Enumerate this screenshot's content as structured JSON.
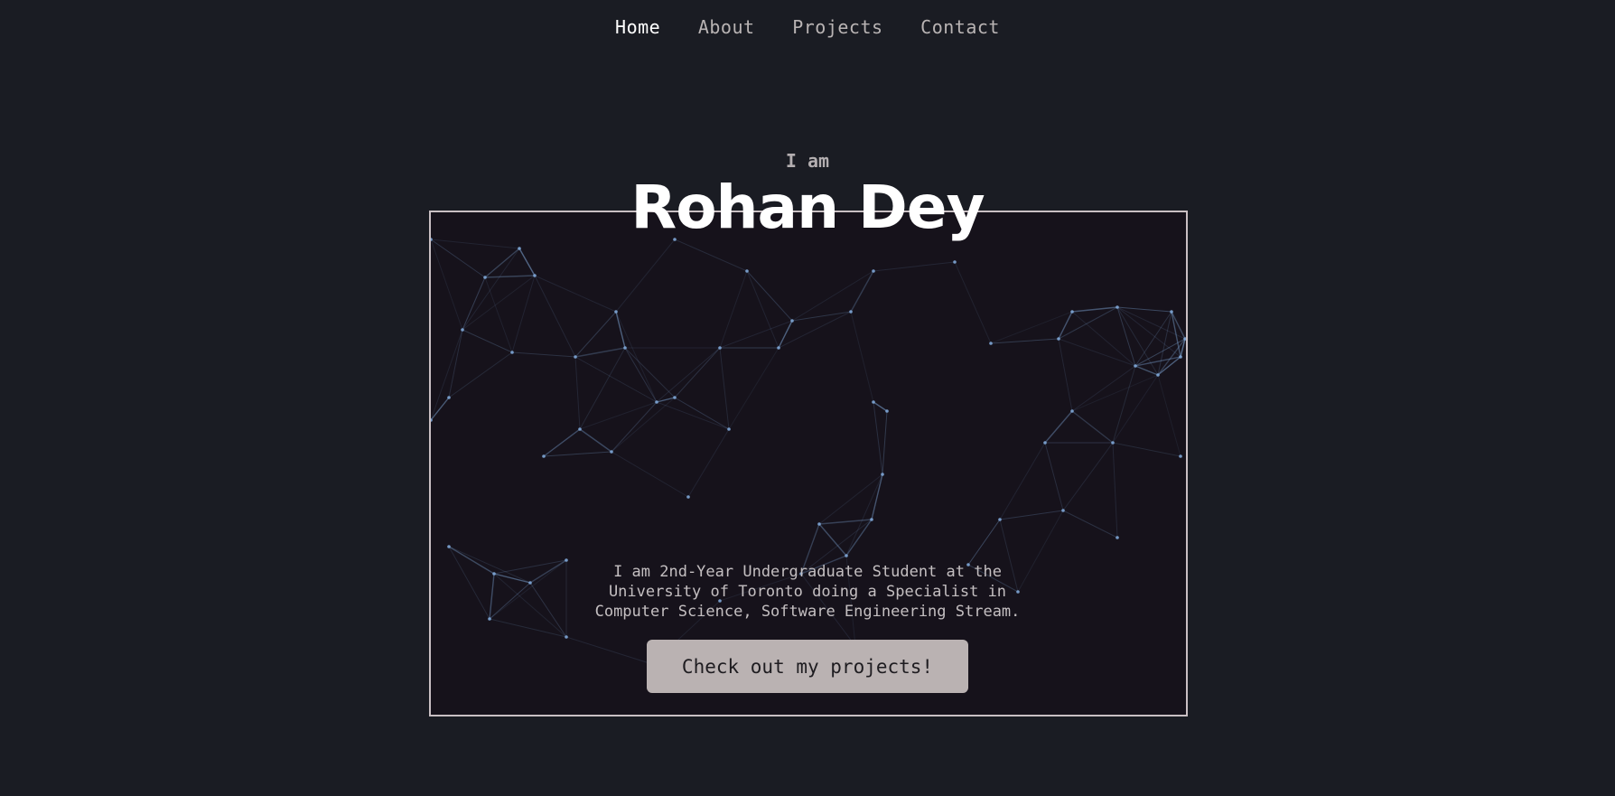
{
  "nav": {
    "items": [
      {
        "label": "Home",
        "active": true
      },
      {
        "label": "About",
        "active": false
      },
      {
        "label": "Projects",
        "active": false
      },
      {
        "label": "Contact",
        "active": false
      }
    ]
  },
  "hero": {
    "intro": "I am",
    "name": "Rohan Dey",
    "description": "I am 2nd-Year Undergraduate Student at the University of Toronto doing a Specialist in Computer Science, Software Engineering Stream.",
    "cta_label": "Check out my projects!"
  },
  "colors": {
    "background": "#1a1c23",
    "frame_background": "#16121b",
    "frame_border": "#c9bfc3",
    "network_line": "#7ea6d6",
    "button_background": "#bab2b2"
  }
}
